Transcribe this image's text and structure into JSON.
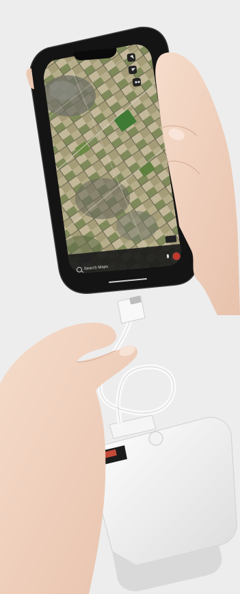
{
  "map_app": {
    "search_placeholder": "Search Maps",
    "icons": {
      "search": "search-icon",
      "layers": "layers-icon",
      "locate": "location-arrow-icon",
      "binoculars": "binoculars-icon",
      "microphone": "microphone-icon",
      "look_around": "look-around-icon",
      "avatar": "avatar-icon"
    }
  },
  "colors": {
    "background": "#ededed",
    "phone_body": "#151515",
    "skin": "#f0d3c0",
    "power_bank": "#f4f4f4"
  }
}
